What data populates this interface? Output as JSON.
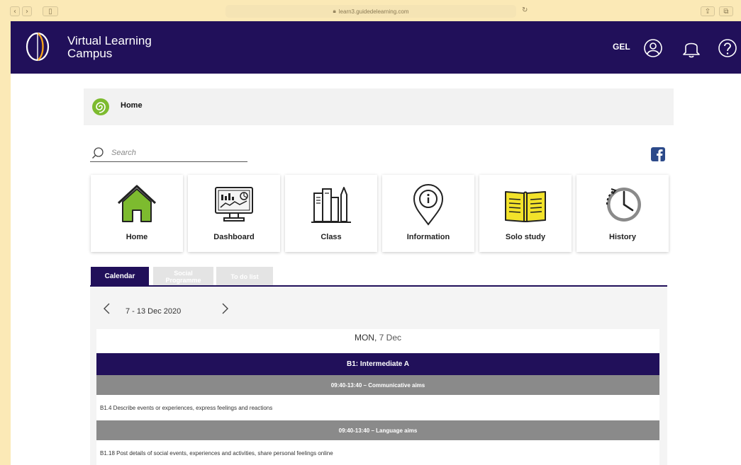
{
  "browser": {
    "url": "learn3.guidedelearning.com"
  },
  "header": {
    "brand_line1": "Virtual Learning",
    "brand_line2": "Campus",
    "user_code": "GEL"
  },
  "breadcrumb": {
    "label": "Home"
  },
  "search": {
    "placeholder": "Search"
  },
  "tiles": [
    {
      "label": "Home",
      "icon": "house-icon"
    },
    {
      "label": "Dashboard",
      "icon": "dashboard-monitor-icon"
    },
    {
      "label": "Class",
      "icon": "class-books-icon"
    },
    {
      "label": "Information",
      "icon": "info-pin-icon"
    },
    {
      "label": "Solo study",
      "icon": "open-book-icon"
    },
    {
      "label": "History",
      "icon": "history-clock-icon"
    }
  ],
  "tabs": {
    "calendar": "Calendar",
    "social_line1": "Social",
    "social_line2": "Programme",
    "todo": "To do list"
  },
  "calendar": {
    "week_range": "7 - 13 Dec 2020",
    "day_name": "MON,",
    "day_date": "7 Dec",
    "course": "B1: Intermediate A",
    "slots": [
      {
        "header": "09:40-13:40 – Communicative aims",
        "text": "B1.4 Describe events or experiences, express feelings and reactions"
      },
      {
        "header": "09:40-13:40 – Language aims",
        "text": "B1.18 Post details of social events, experiences and activities, share personal feelings online"
      }
    ]
  },
  "colors": {
    "navy": "#21105a",
    "green": "#7dbb2f",
    "yellow": "#f2e22a",
    "slot_gray": "#8a8a8a"
  }
}
